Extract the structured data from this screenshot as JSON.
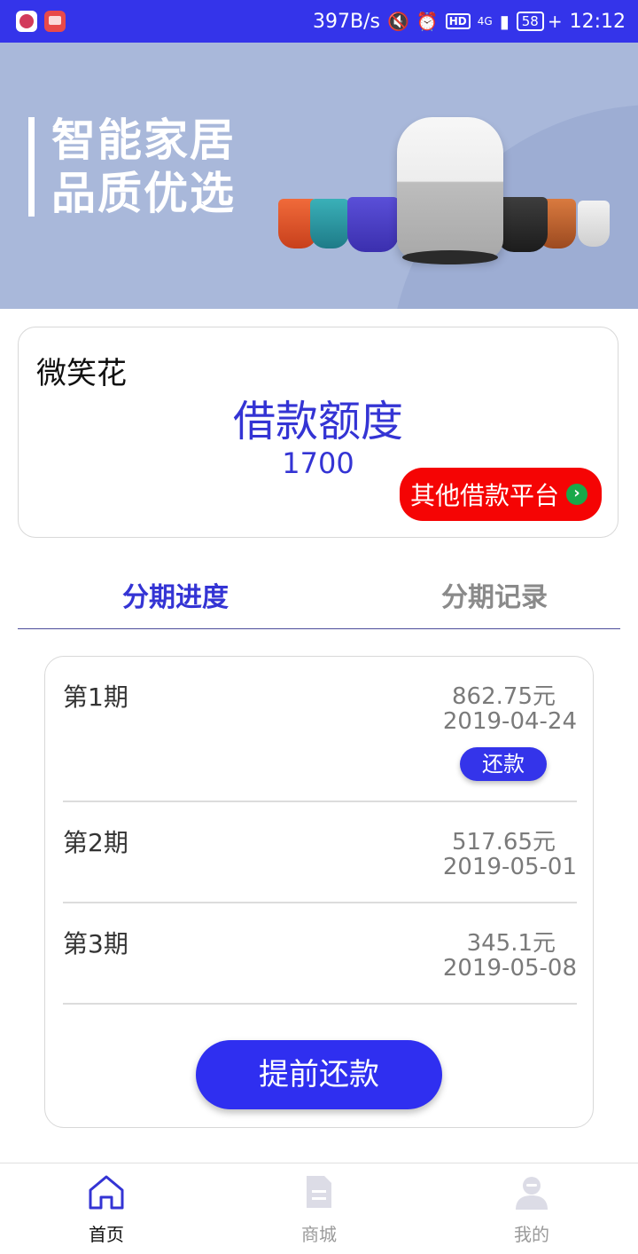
{
  "status_bar": {
    "net_speed": "397B/s",
    "hd": "HD",
    "network": "4G",
    "battery": "58",
    "time": "12:12"
  },
  "banner": {
    "title_line1": "智能家居",
    "title_line2": "品质优选"
  },
  "loan_card": {
    "app_name": "微笑花",
    "credit_label": "借款额度",
    "credit_amount": "1700",
    "other_platform_button": "其他借款平台"
  },
  "tabs": [
    {
      "label": "分期进度",
      "active": true
    },
    {
      "label": "分期记录",
      "active": false
    }
  ],
  "installments": [
    {
      "period": "第1期",
      "amount": "862.75元",
      "date": "2019-04-24",
      "action": "还款"
    },
    {
      "period": "第2期",
      "amount": "517.65元",
      "date": "2019-05-01"
    },
    {
      "period": "第3期",
      "amount": "345.1元",
      "date": "2019-05-08"
    }
  ],
  "prepay_button": "提前还款",
  "bottom_nav": [
    {
      "label": "首页",
      "icon": "home-icon",
      "active": true
    },
    {
      "label": "商城",
      "icon": "document-icon",
      "active": false
    },
    {
      "label": "我的",
      "icon": "user-icon",
      "active": false
    }
  ],
  "colors": {
    "primary": "#3434ea",
    "alert_red": "#f50404",
    "banner_bg": "#a9b8da"
  }
}
